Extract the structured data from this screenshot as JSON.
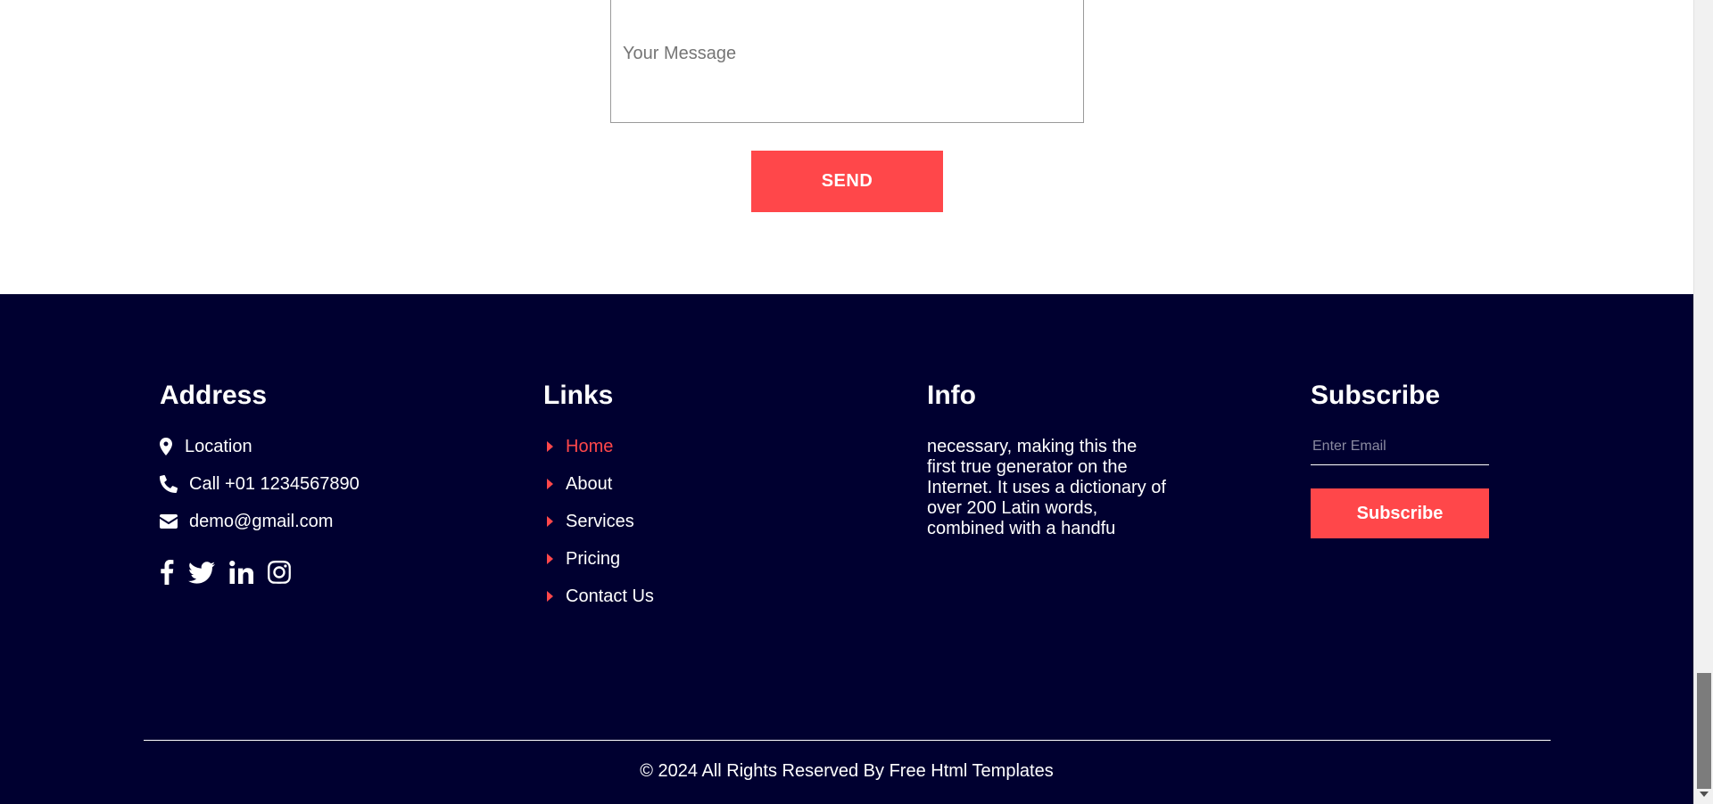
{
  "contact_form": {
    "message_placeholder": "Your Message",
    "send_label": "SEND"
  },
  "footer": {
    "address": {
      "title": "Address",
      "location": "Location",
      "phone": "Call +01 1234567890",
      "email": "demo@gmail.com",
      "social_icons": [
        "facebook-icon",
        "twitter-icon",
        "linkedin-icon",
        "instagram-icon"
      ]
    },
    "links": {
      "title": "Links",
      "items": [
        {
          "label": "Home",
          "active": true
        },
        {
          "label": "About",
          "active": false
        },
        {
          "label": "Services",
          "active": false
        },
        {
          "label": "Pricing",
          "active": false
        },
        {
          "label": "Contact Us",
          "active": false
        }
      ]
    },
    "info": {
      "title": "Info",
      "text": "necessary, making this the first true generator on the Internet. It uses a dictionary of over 200 Latin words, combined with a handfu"
    },
    "subscribe": {
      "title": "Subscribe",
      "email_placeholder": "Enter Email",
      "button_label": "Subscribe"
    },
    "copyright": "© 2024 All Rights Reserved By Free Html Templates"
  },
  "colors": {
    "accent": "#ff474a",
    "footer_bg": "#000030",
    "text_light": "#ffffff"
  }
}
